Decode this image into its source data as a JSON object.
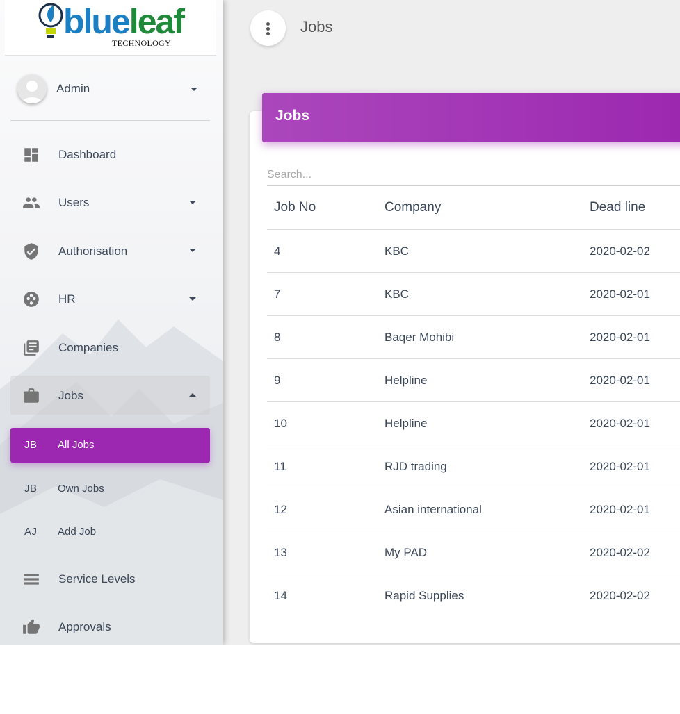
{
  "brand": {
    "name_blue": "blue",
    "name_green": "leaf",
    "sub": "TECHNOLOGY"
  },
  "user": {
    "name": "Admin"
  },
  "sidebar": {
    "items": [
      {
        "label": "Dashboard",
        "icon": "dashboard-icon"
      },
      {
        "label": "Users",
        "icon": "users-icon"
      },
      {
        "label": "Authorisation",
        "icon": "shield-check-icon"
      },
      {
        "label": "HR",
        "icon": "mood-icon"
      },
      {
        "label": "Companies",
        "icon": "library-books-icon"
      },
      {
        "label": "Jobs",
        "icon": "briefcase-icon"
      },
      {
        "label": "Service Levels",
        "icon": "stack-icon"
      },
      {
        "label": "Approvals",
        "icon": "thumb-up-icon"
      }
    ],
    "jobs_sub": [
      {
        "abbr": "JB",
        "label": "All Jobs"
      },
      {
        "abbr": "JB",
        "label": "Own Jobs"
      },
      {
        "abbr": "AJ",
        "label": "Add Job"
      }
    ]
  },
  "topbar": {
    "title": "Jobs"
  },
  "card": {
    "title": "Jobs",
    "search_placeholder": "Search...",
    "columns": [
      "Job No",
      "Company",
      "Dead line"
    ],
    "rows": [
      [
        "4",
        "KBC",
        "2020-02-02"
      ],
      [
        "7",
        "KBC",
        "2020-02-01"
      ],
      [
        "8",
        "Baqer Mohibi",
        "2020-02-01"
      ],
      [
        "9",
        "Helpline",
        "2020-02-01"
      ],
      [
        "10",
        "Helpline",
        "2020-02-01"
      ],
      [
        "11",
        "RJD trading",
        "2020-02-01"
      ],
      [
        "12",
        "Asian international",
        "2020-02-01"
      ],
      [
        "13",
        "My PAD",
        "2020-02-02"
      ],
      [
        "14",
        "Rapid Supplies",
        "2020-02-02"
      ]
    ]
  },
  "colors": {
    "accent": "#9c27b0",
    "text": "#3c4858",
    "icon": "#757575"
  }
}
